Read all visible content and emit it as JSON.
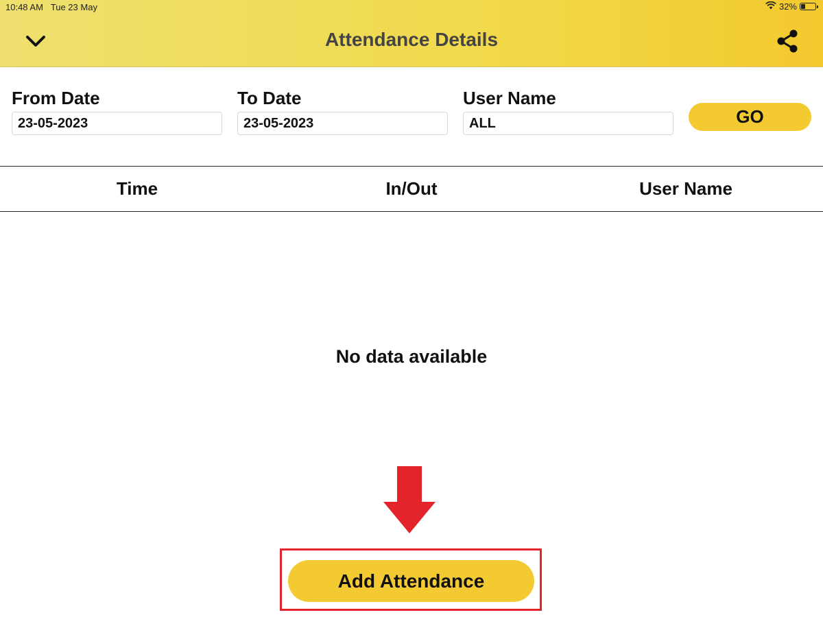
{
  "status_bar": {
    "time": "10:48 AM",
    "date": "Tue 23 May",
    "battery_text": "32%",
    "battery_level": 0.32,
    "wifi_icon": "wifi-icon"
  },
  "header": {
    "title": "Attendance Details",
    "back_icon": "chevron-down-icon",
    "share_icon": "share-icon"
  },
  "filters": {
    "from_date": {
      "label": "From Date",
      "value": "23-05-2023"
    },
    "to_date": {
      "label": "To Date",
      "value": "23-05-2023"
    },
    "user_name": {
      "label": "User Name",
      "value": "ALL"
    },
    "go_label": "GO"
  },
  "table": {
    "columns": [
      "Time",
      "In/Out",
      "User Name"
    ],
    "rows": [],
    "empty_message": "No data available"
  },
  "annotation": {
    "arrow_icon": "arrow-down-icon",
    "color": "#e3242b"
  },
  "add_button_label": "Add Attendance",
  "colors": {
    "accent": "#f4ca33",
    "header_gradient_start": "#efe070",
    "header_gradient_end": "#f3c92e"
  }
}
